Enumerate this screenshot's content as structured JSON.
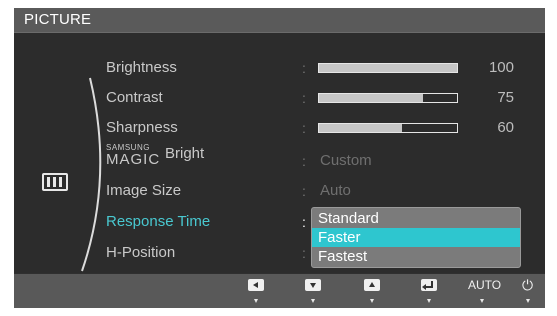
{
  "window": {
    "title": "PICTURE"
  },
  "menu": {
    "brightness": {
      "label": "Brightness",
      "value": "100",
      "level": 1.0
    },
    "contrast": {
      "label": "Contrast",
      "value": "75",
      "level": 0.75
    },
    "sharpness": {
      "label": "Sharpness",
      "value": "60",
      "level": 0.6
    },
    "magic_bright": {
      "brand": "SAMSUNG",
      "label_magic": "MAGIC",
      "label": "Bright",
      "value": "Custom"
    },
    "image_size": {
      "label": "Image Size",
      "value": "Auto"
    },
    "response_time": {
      "label": "Response Time"
    },
    "h_position": {
      "label": "H-Position"
    },
    "separator": ":"
  },
  "dropdown": {
    "options": [
      "Standard",
      "Faster",
      "Fastest"
    ],
    "highlighted": "Faster"
  },
  "bottom_bar": {
    "buttons": [
      {
        "icon": "left-arrow-icon"
      },
      {
        "icon": "down-arrow-icon"
      },
      {
        "icon": "up-arrow-icon"
      },
      {
        "icon": "enter-icon"
      },
      {
        "label": "AUTO"
      },
      {
        "icon": "power-icon"
      }
    ]
  },
  "colors": {
    "accent": "#49c8d0",
    "highlight": "#2ec6cf",
    "dropdown_bg": "#7b7b7b"
  }
}
